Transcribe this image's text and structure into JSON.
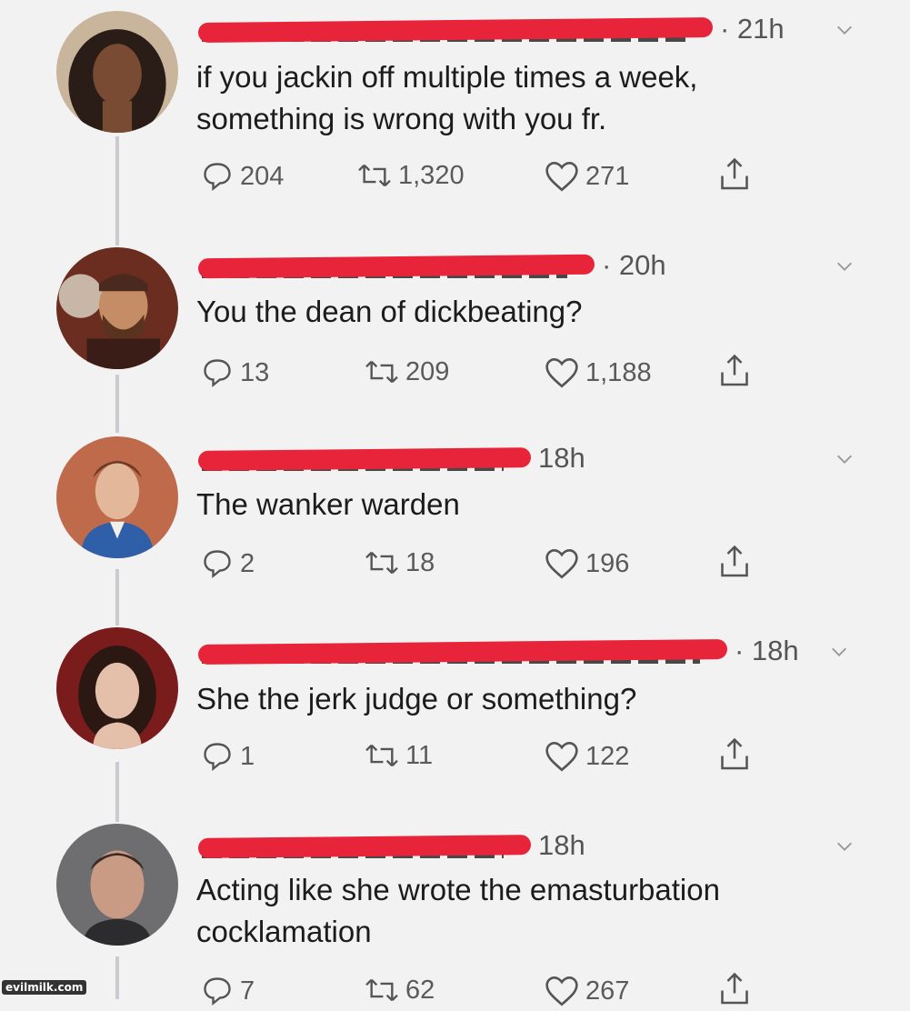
{
  "tweets": [
    {
      "name": "",
      "time": "· 21h",
      "text": "if you jackin off multiple times a week,\nsomething is wrong with you fr.",
      "replies": "204",
      "retweets": "1,320",
      "likes": "271"
    },
    {
      "name": "",
      "time": "· 20h",
      "text": "You the dean of dickbeating?",
      "replies": "13",
      "retweets": "209",
      "likes": "1,188"
    },
    {
      "name": "",
      "time": "18h",
      "text": "The wanker warden",
      "replies": "2",
      "retweets": "18",
      "likes": "196"
    },
    {
      "name": "",
      "time": "· 18h",
      "text": "She the jerk judge or something?",
      "replies": "1",
      "retweets": "11",
      "likes": "122"
    },
    {
      "name": "",
      "time": "18h",
      "text": "Acting like she wrote the emasturbation\ncocklamation",
      "replies": "7",
      "retweets": "62",
      "likes": "267"
    }
  ],
  "watermark": "evilmilk.com",
  "colors": {
    "redaction": "#e8243a",
    "background": "#f3f2f3",
    "thread": "#c9cbd0"
  }
}
